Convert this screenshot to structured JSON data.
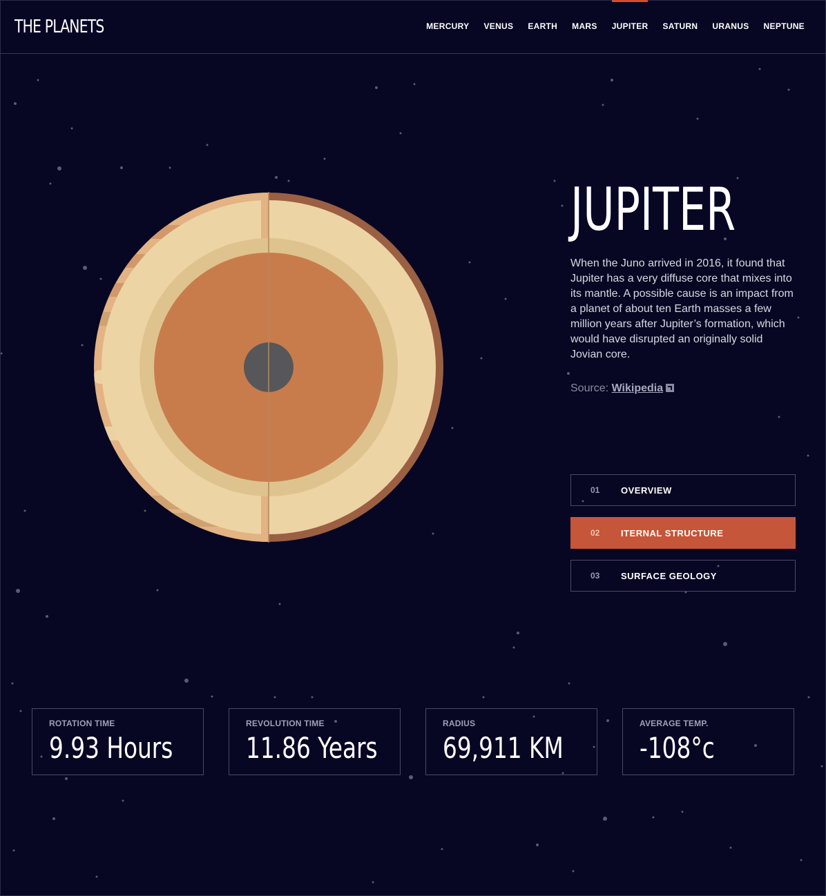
{
  "app": {
    "logo": "THE PLANETS"
  },
  "nav": {
    "items": [
      {
        "label": "MERCURY",
        "active": false
      },
      {
        "label": "VENUS",
        "active": false
      },
      {
        "label": "EARTH",
        "active": false
      },
      {
        "label": "MARS",
        "active": false
      },
      {
        "label": "JUPITER",
        "active": true
      },
      {
        "label": "SATURN",
        "active": false
      },
      {
        "label": "URANUS",
        "active": false
      },
      {
        "label": "NEPTUNE",
        "active": false
      }
    ]
  },
  "planet": {
    "name": "JUPITER",
    "description": "When the Juno arrived in 2016, it found that Jupiter has a very diffuse core that mixes into its mantle. A possible cause is an impact from a planet of about ten Earth masses a few million years after Jupiter’s formation, which would have disrupted an originally solid Jovian core.",
    "source_label": "Source:",
    "source_link": "Wikipedia",
    "illustration_icon": "jupiter-internal-structure-icon"
  },
  "tabs": [
    {
      "num": "01",
      "label": "OVERVIEW",
      "active": false
    },
    {
      "num": "02",
      "label": "ITERNAL STRUCTURE",
      "active": true
    },
    {
      "num": "03",
      "label": "SURFACE GEOLOGY",
      "active": false
    }
  ],
  "stats": [
    {
      "label": "ROTATION TIME",
      "value": "9.93 Hours"
    },
    {
      "label": "REVOLUTION TIME",
      "value": "11.86 Years"
    },
    {
      "label": "RADIUS",
      "value": "69,911 KM"
    },
    {
      "label": "AVERAGE TEMP.",
      "value": "-108°c"
    }
  ],
  "colors": {
    "background": "#070724",
    "accent": "#d14c32",
    "active_tab": "#c5563a",
    "border": "#38384f"
  }
}
